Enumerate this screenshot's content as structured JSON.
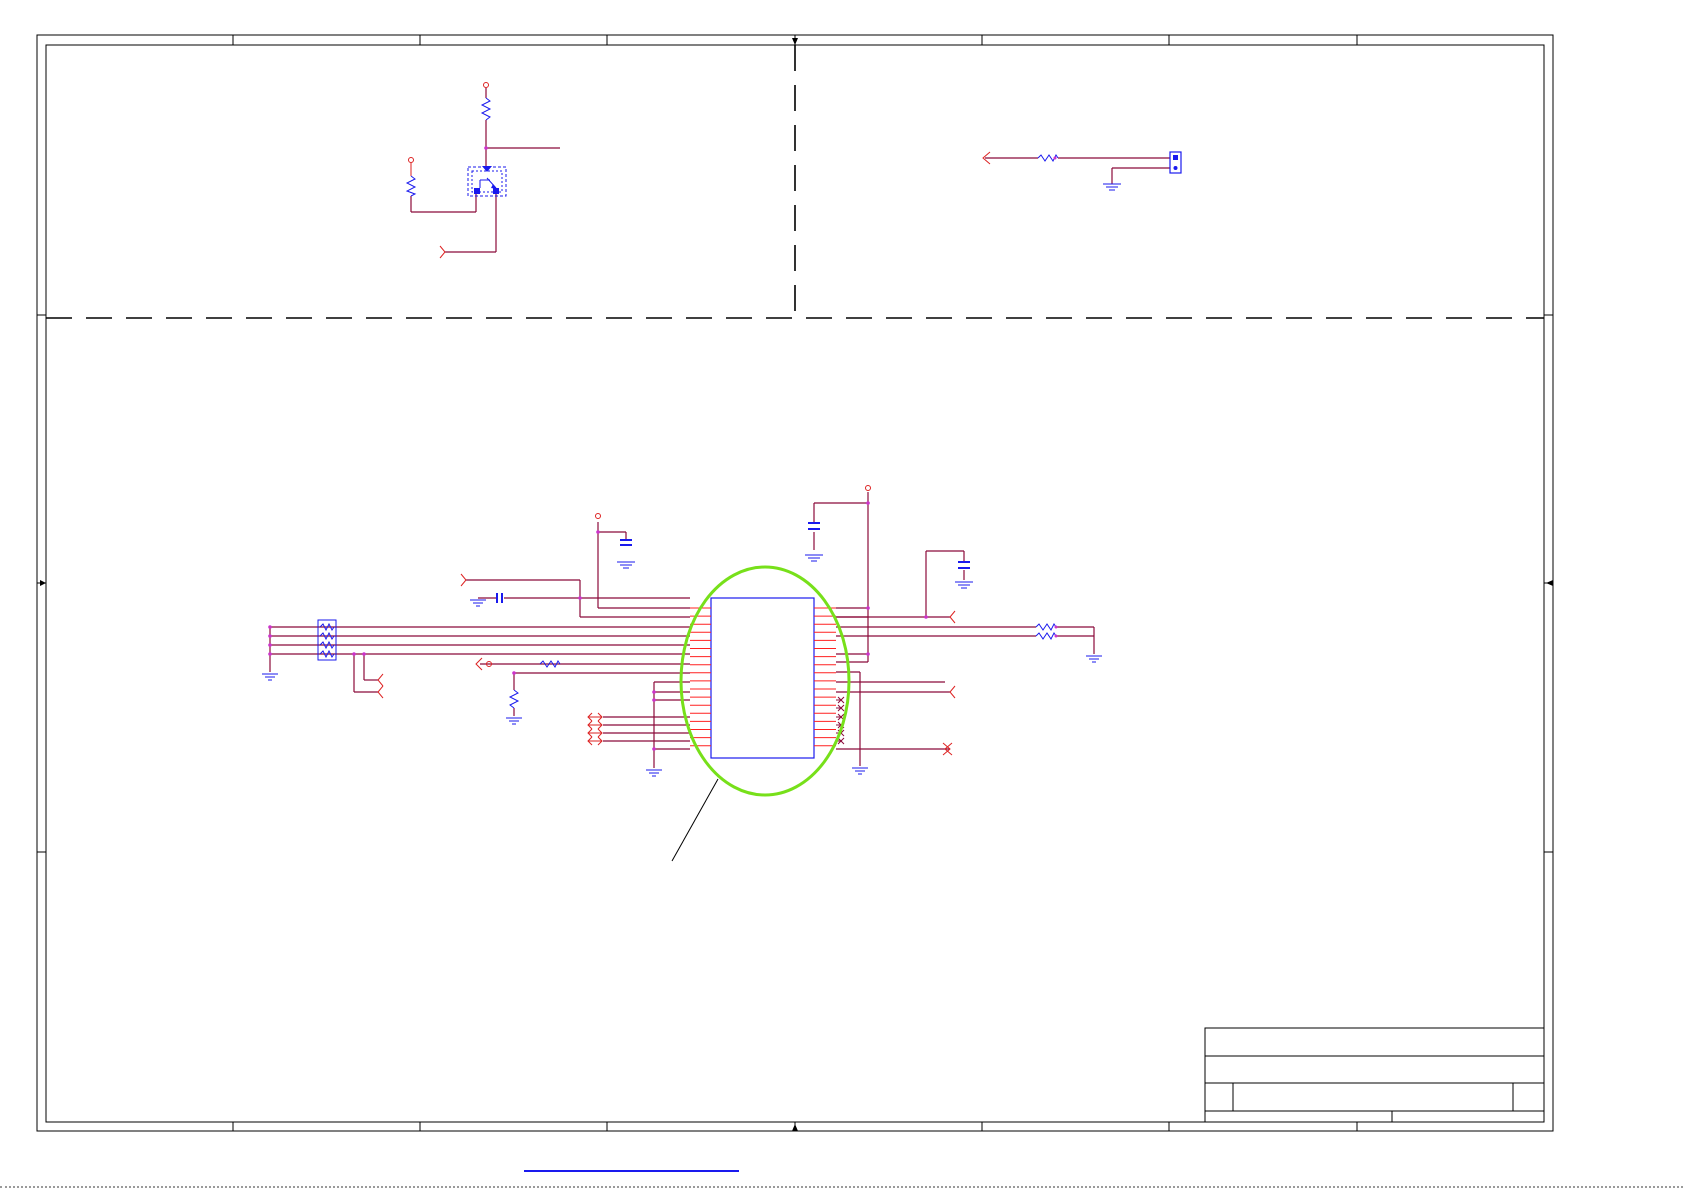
{
  "sheet": {
    "colors": {
      "border": "#000000",
      "wire": "#8b0a3a",
      "pin": "#ff2020",
      "component": "#1a1aee",
      "junction": "#cc33cc",
      "highlight": "#77e01a",
      "annotation": "#000000"
    },
    "footer_link": {
      "text": ""
    },
    "title_block": {
      "title": "",
      "subtitle": "",
      "size": "",
      "doc_number": "",
      "rev": "",
      "date": "",
      "sheet": ""
    }
  }
}
